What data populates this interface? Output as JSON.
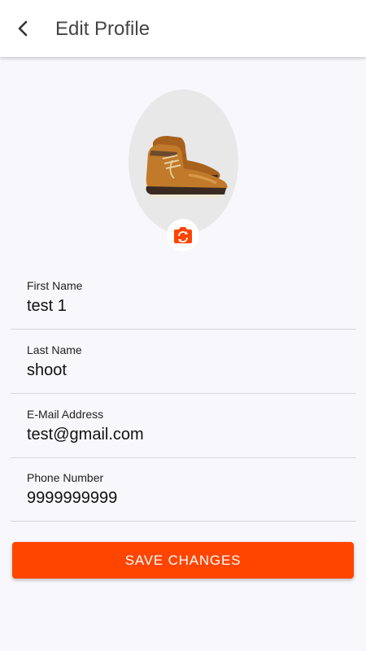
{
  "header": {
    "title": "Edit Profile",
    "back_icon": "arrow-back-icon"
  },
  "profile": {
    "avatar_image": "brown leather boot",
    "camera_icon": "camera-switch-icon"
  },
  "fields": [
    {
      "label": "First Name",
      "value": "test 1"
    },
    {
      "label": "Last Name",
      "value": "shoot"
    },
    {
      "label": "E-Mail Address",
      "value": "test@gmail.com"
    },
    {
      "label": "Phone Number",
      "value": "9999999999"
    }
  ],
  "actions": {
    "save_label": "SAVE CHANGES"
  },
  "colors": {
    "accent": "#ff4500",
    "background": "#f7f7fc",
    "app_bar": "#ffffff",
    "avatar_bg": "#e8e8e8"
  }
}
